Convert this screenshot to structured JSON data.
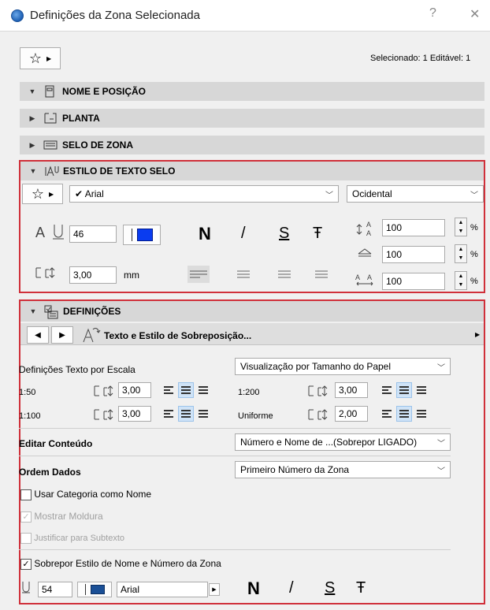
{
  "window": {
    "title": "Definições da Zona Selecionada",
    "help": "?",
    "close": "✕"
  },
  "top": {
    "selection_info": "Selecionado: 1 Editável: 1"
  },
  "panels": {
    "name_position": "NOME E POSIÇÃO",
    "plan": "PLANTA",
    "zone_stamp": "SELO DE ZONA",
    "text_style": "ESTILO DE TEXTO SELO",
    "settings": "DEFINIÇÕES"
  },
  "text_style": {
    "font": "Arial",
    "script": "Ocidental",
    "size": "46",
    "bold": "N",
    "italic": "/",
    "underline": "S",
    "strike": "Ŧ",
    "spacing": "3,00",
    "spacing_unit": "mm",
    "percent1": "100",
    "percent2": "100",
    "percent3": "100",
    "pct": "%",
    "color": "#0a3cf0"
  },
  "settings": {
    "nav_title": "Texto e Estilo de Sobreposição...",
    "scale_label": "Definições Texto por Escala",
    "scale_mode": "Visualização por Tamanho do Papel",
    "rows": [
      {
        "scale": "1:50",
        "value": "3,00"
      },
      {
        "scale": "1:100",
        "value": "3,00"
      },
      {
        "scale": "1:200",
        "value": "3,00"
      },
      {
        "scale": "Uniforme",
        "value": "2,00"
      }
    ],
    "edit_content_label": "Editar Conteúdo",
    "edit_content_value": "Número e Nome de ...(Sobrepor LIGADO)",
    "order_label": "Ordem Dados",
    "order_value": "Primeiro Número da Zona",
    "use_category": "Usar Categoria como Nome",
    "show_frame": "Mostrar Moldura",
    "justify_subtext": "Justificar para Subtexto",
    "override_style": "Sobrepor Estilo de Nome e Número da Zona",
    "bottom_size": "54",
    "bottom_font": "Arial",
    "bottom_color": "#1a4f96"
  }
}
